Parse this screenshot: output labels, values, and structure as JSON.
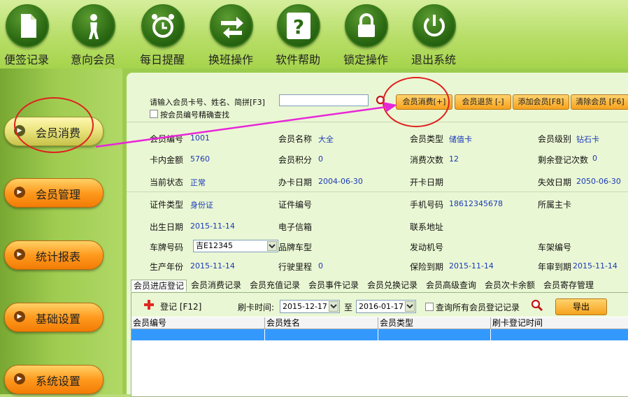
{
  "toolbar": {
    "items": [
      {
        "label": "便签记录",
        "icon": "document-icon"
      },
      {
        "label": "意向会员",
        "icon": "person-icon"
      },
      {
        "label": "每日提醒",
        "icon": "alarm-clock-icon"
      },
      {
        "label": "换班操作",
        "icon": "swap-arrows-icon"
      },
      {
        "label": "软件帮助",
        "icon": "question-icon"
      },
      {
        "label": "锁定操作",
        "icon": "lock-icon"
      },
      {
        "label": "退出系统",
        "icon": "power-icon"
      }
    ]
  },
  "sidebar": {
    "items": [
      {
        "label": "会员消费",
        "active": true
      },
      {
        "label": "会员管理"
      },
      {
        "label": "统计报表"
      },
      {
        "label": "基础设置"
      },
      {
        "label": "系统设置"
      }
    ]
  },
  "search": {
    "label": "请输入会员卡号、姓名、简拼[F3]",
    "value": "",
    "exact_label": "按会员编号精确查找"
  },
  "actions": {
    "consume": "会员消费[+]",
    "refund": "会员退货 [-]",
    "add": "添加会员[F8]",
    "clear": "清除会员 [F6]"
  },
  "member": {
    "id_label": "会员编号",
    "id_value": "1001",
    "name_label": "会员名称",
    "name_value": "大全",
    "type_label": "会员类型",
    "type_value": "储值卡",
    "level_label": "会员级别",
    "level_value": "钻石卡",
    "balance_label": "卡内金额",
    "balance_value": "5760",
    "points_label": "会员积分",
    "points_value": "0",
    "visits_label": "消费次数",
    "visits_value": "12",
    "remaining_label": "剩余登记次数",
    "remaining_value": "0",
    "status_label": "当前状态",
    "status_value": "正常",
    "issue_label": "办卡日期",
    "issue_value": "2004-06-30",
    "open_label": "开卡日期",
    "open_value": "",
    "expire_label": "失效日期",
    "expire_value": "2050-06-30",
    "cert_type_label": "证件类型",
    "cert_type_value": "身份证",
    "cert_no_label": "证件编号",
    "cert_no_value": "",
    "phone_label": "手机号码",
    "phone_value": "18612345678",
    "owner_label": "所属主卡",
    "owner_value": "",
    "birth_label": "出生日期",
    "birth_value": "2015-11-14",
    "email_label": "电子信箱",
    "email_value": "",
    "address_label": "联系地址",
    "address_value": "",
    "plate_label": "车牌号码",
    "plate_value": "吉E12345",
    "brand_label": "品牌车型",
    "brand_value": "",
    "engine_label": "发动机号",
    "engine_value": "",
    "frame_label": "车架编号",
    "frame_value": "",
    "year_label": "生产年份",
    "year_value": "2015-11-14",
    "mileage_label": "行驶里程",
    "mileage_value": "0",
    "insurance_label": "保险到期",
    "insurance_value": "2015-11-14",
    "inspection_label": "年审到期",
    "inspection_value": "2015-11-14"
  },
  "tabs": [
    "会员进店登记",
    "会员消费记录",
    "会员充值记录",
    "会员事件记录",
    "会员兑换记录",
    "会员高级查询",
    "会员次卡余额",
    "会员寄存管理"
  ],
  "records": {
    "register_label": "登记 [F12]",
    "time_label": "刷卡时间:",
    "date_from": "2015-12-17",
    "to_label": "至",
    "date_to": "2016-01-17",
    "query_all_label": "查询所有会员登记记录",
    "export_label": "导出",
    "columns": [
      "会员编号",
      "会员姓名",
      "会员类型",
      "刷卡登记时间"
    ]
  }
}
